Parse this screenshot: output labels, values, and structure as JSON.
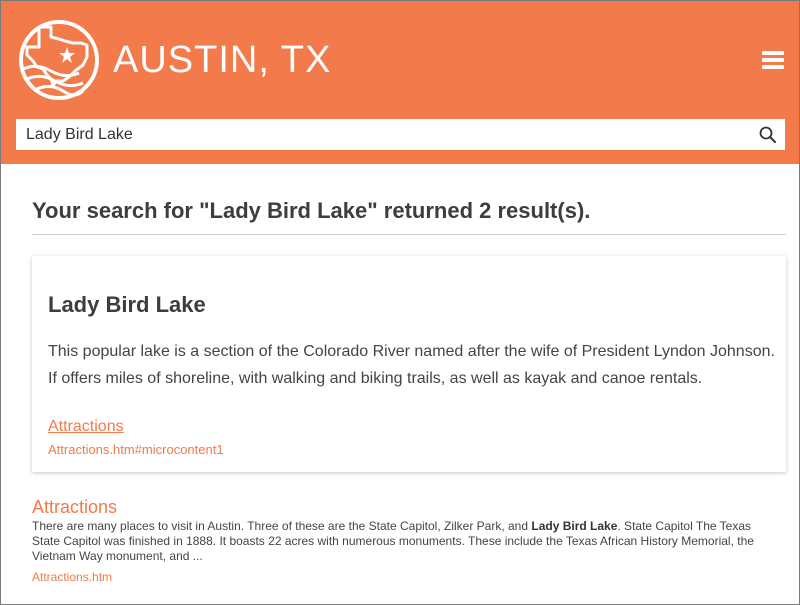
{
  "header": {
    "site_title": "AUSTIN, TX",
    "logo_icon": "texas-star-logo-icon",
    "menu_icon": "hamburger-menu-icon",
    "background_color": "#f37a4a"
  },
  "search": {
    "value": "Lady Bird Lake",
    "icon": "search-icon"
  },
  "results": {
    "heading": "Your search for \"Lady Bird Lake\" returned 2 result(s).",
    "featured": {
      "title": "Lady Bird Lake",
      "description": "This popular lake is a section of the Colorado River named after the wife of President Lyndon Johnson. If offers miles of shoreline, with walking and biking trails, as well as kayak and canoe rentals.",
      "link_label": "Attractions",
      "url": "Attractions.htm#microcontent1"
    },
    "second": {
      "title": "Attractions",
      "snippet_before": "There are many places to visit in Austin. Three of these are the State Capitol, Zilker Park, and ",
      "snippet_highlight": "Lady Bird Lake",
      "snippet_after": ". State Capitol The Texas State Capitol was finished in 1888. It boasts 22 acres with numerous monuments. These include the Texas African History Memorial, the Vietnam Way monument, and ...",
      "url": "Attractions.htm"
    }
  },
  "accent_color": "#f37a4a"
}
